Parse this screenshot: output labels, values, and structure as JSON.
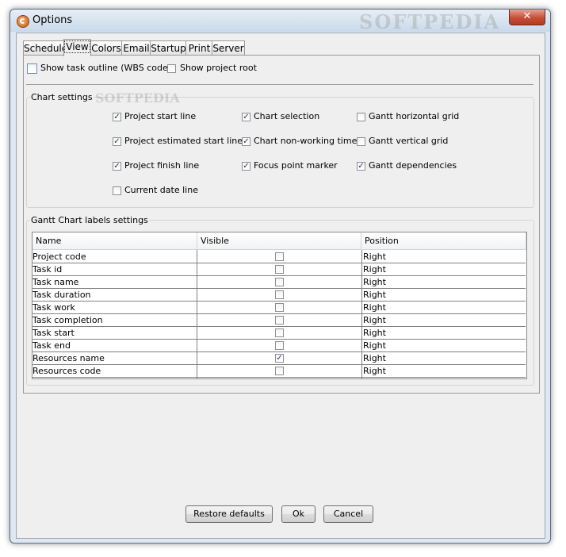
{
  "window": {
    "title": "Options",
    "close_glyph": "✕"
  },
  "tabs": [
    "Schedule",
    "View",
    "Colors",
    "Email",
    "Startup",
    "Print",
    "Server"
  ],
  "active_tab": "View",
  "top_options": [
    {
      "label": "Show task outline (WBS code)",
      "checked": false
    },
    {
      "label": "Show project root",
      "checked": false
    }
  ],
  "chart_settings": {
    "title": "Chart settings",
    "items": [
      {
        "label": "Project start line",
        "checked": true
      },
      {
        "label": "Project estimated start line",
        "checked": true
      },
      {
        "label": "Project finish line",
        "checked": true
      },
      {
        "label": "Current date line",
        "checked": false
      },
      {
        "label": "Chart selection",
        "checked": true
      },
      {
        "label": "Chart non-working time",
        "checked": true
      },
      {
        "label": "Focus point marker",
        "checked": true
      },
      {
        "label": "Gantt horizontal grid",
        "checked": false
      },
      {
        "label": "Gantt vertical grid",
        "checked": false
      },
      {
        "label": "Gantt dependencies",
        "checked": true
      }
    ]
  },
  "labels_settings": {
    "title": "Gantt Chart labels settings",
    "columns": [
      "Name",
      "Visible",
      "Position"
    ],
    "rows": [
      {
        "name": "Project code",
        "visible": false,
        "position": "Right"
      },
      {
        "name": "Task id",
        "visible": false,
        "position": "Right"
      },
      {
        "name": "Task name",
        "visible": false,
        "position": "Right"
      },
      {
        "name": "Task duration",
        "visible": false,
        "position": "Right"
      },
      {
        "name": "Task work",
        "visible": false,
        "position": "Right"
      },
      {
        "name": "Task completion",
        "visible": false,
        "position": "Right"
      },
      {
        "name": "Task start",
        "visible": false,
        "position": "Right"
      },
      {
        "name": "Task end",
        "visible": false,
        "position": "Right"
      },
      {
        "name": "Resources name",
        "visible": true,
        "position": "Right"
      },
      {
        "name": "Resources code",
        "visible": false,
        "position": "Right"
      }
    ]
  },
  "buttons": {
    "restore": "Restore defaults",
    "ok": "Ok",
    "cancel": "Cancel"
  },
  "check_glyph": "✓",
  "watermark": "SOFTPEDIA"
}
